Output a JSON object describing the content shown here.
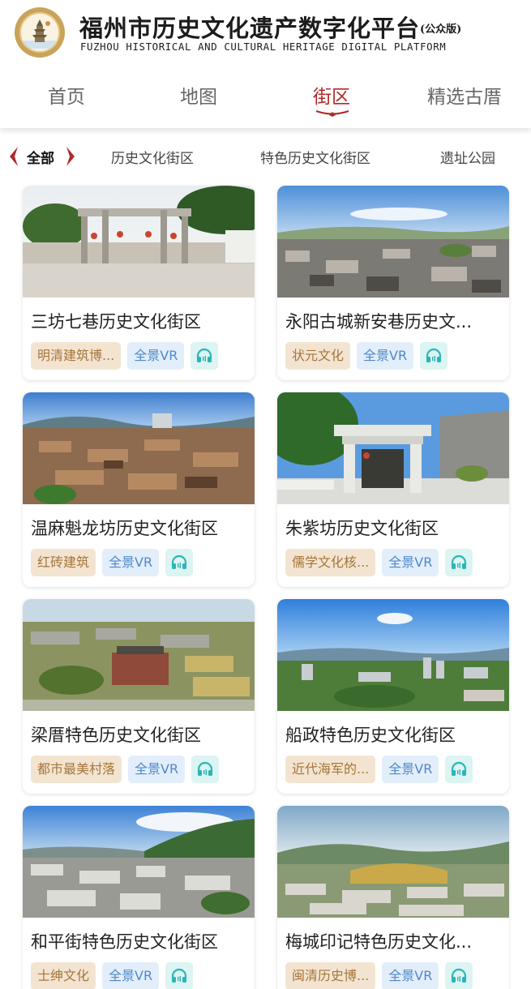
{
  "header": {
    "title_cn": "福州市历史文化遗产数字化平台",
    "title_badge": "(公众版)",
    "title_en": "FUZHOU HISTORICAL AND CULTURAL HERITAGE DIGITAL PLATFORM"
  },
  "nav": {
    "tabs": [
      {
        "label": "首页"
      },
      {
        "label": "地图"
      },
      {
        "label": "街区"
      },
      {
        "label": "精选古厝"
      }
    ],
    "active": "街区"
  },
  "filter": {
    "items": [
      {
        "label": "全部"
      },
      {
        "label": "历史文化街区"
      },
      {
        "label": "特色历史文化街区"
      },
      {
        "label": "遗址公园"
      }
    ],
    "active": "全部"
  },
  "cards": [
    {
      "name": "三坊七巷历史文化街区",
      "tag": "明清建筑博...",
      "vr": "全景VR",
      "image": "archway-street-photo"
    },
    {
      "name": "永阳古城新安巷历史文...",
      "tag": "状元文化",
      "vr": "全景VR",
      "image": "aerial-old-town-photo"
    },
    {
      "name": "温麻魁龙坊历史文化街区",
      "tag": "红砖建筑",
      "vr": "全景VR",
      "image": "aerial-rooftops-photo"
    },
    {
      "name": "朱紫坊历史文化街区",
      "tag": "儒学文化核...",
      "vr": "全景VR",
      "image": "stone-gate-photo"
    },
    {
      "name": "梁厝特色历史文化街区",
      "tag": "都市最美村落",
      "vr": "全景VR",
      "image": "aerial-village-photo"
    },
    {
      "name": "船政特色历史文化街区",
      "tag": "近代海军的...",
      "vr": "全景VR",
      "image": "aerial-city-river-photo"
    },
    {
      "name": "和平街特色历史文化街区",
      "tag": "士绅文化",
      "vr": "全景VR",
      "image": "aerial-town-photo"
    },
    {
      "name": "梅城印记特色历史文化...",
      "tag": "闽清历史博...",
      "vr": "全景VR",
      "image": "aerial-hills-town-photo"
    }
  ],
  "colors": {
    "accent": "#b12a2a",
    "tag_brown_bg": "#f3e4d1",
    "tag_brown_text": "#a6763a",
    "tag_blue_bg": "#e3eefb",
    "tag_blue_text": "#4e88c9",
    "tag_teal_bg": "#dcf4f2",
    "headphone_icon": "#2bb5b8"
  },
  "icons": {
    "logo": "pagoda-emblem-icon",
    "audio": "headphones-icon",
    "filter_left": "chevron-left-icon",
    "filter_right": "chevron-right-icon"
  }
}
